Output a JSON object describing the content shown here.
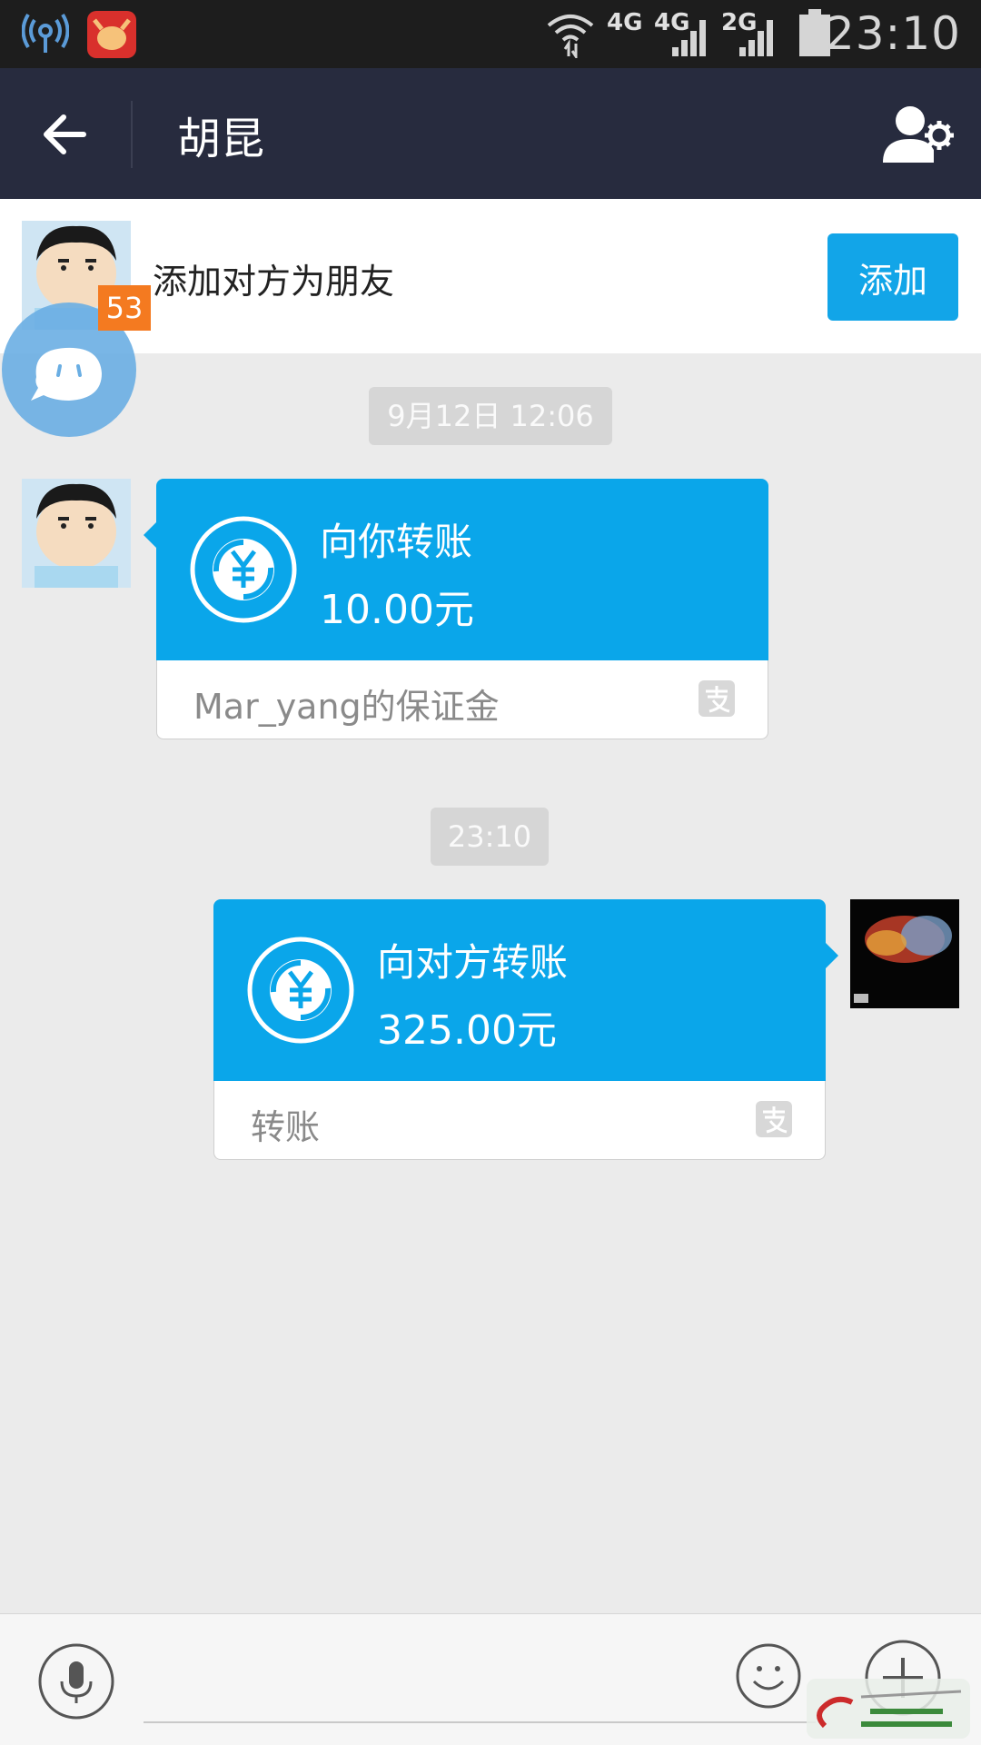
{
  "status_bar": {
    "time": "23:10",
    "network_1": "4G",
    "network_2": "4G",
    "network_3": "2G"
  },
  "header": {
    "title": "胡昆"
  },
  "add_friend_bar": {
    "prompt": "添加对方为朋友",
    "button_label": "添加",
    "badge_count": "53"
  },
  "messages": [
    {
      "timestamp": "9月12日 12:06",
      "direction": "incoming",
      "label": "向你转账",
      "amount": "10.00元",
      "note": "Mar_yang的保证金"
    },
    {
      "timestamp": "23:10",
      "direction": "outgoing",
      "label": "向对方转账",
      "amount": "325.00元",
      "note": "转账"
    }
  ],
  "input_bar": {
    "placeholder": ""
  },
  "colors": {
    "header_bg": "#272b3e",
    "accent": "#12a5e8",
    "card_blue": "#0aa6ea",
    "badge_orange": "#f47a20"
  },
  "icons": {
    "back": "arrow-left-icon",
    "profile": "user-settings-icon",
    "transfer": "yuan-transfer-icon",
    "alipay": "alipay-logo-icon",
    "mic": "microphone-icon",
    "emoji": "smiley-icon",
    "plus": "plus-icon"
  }
}
